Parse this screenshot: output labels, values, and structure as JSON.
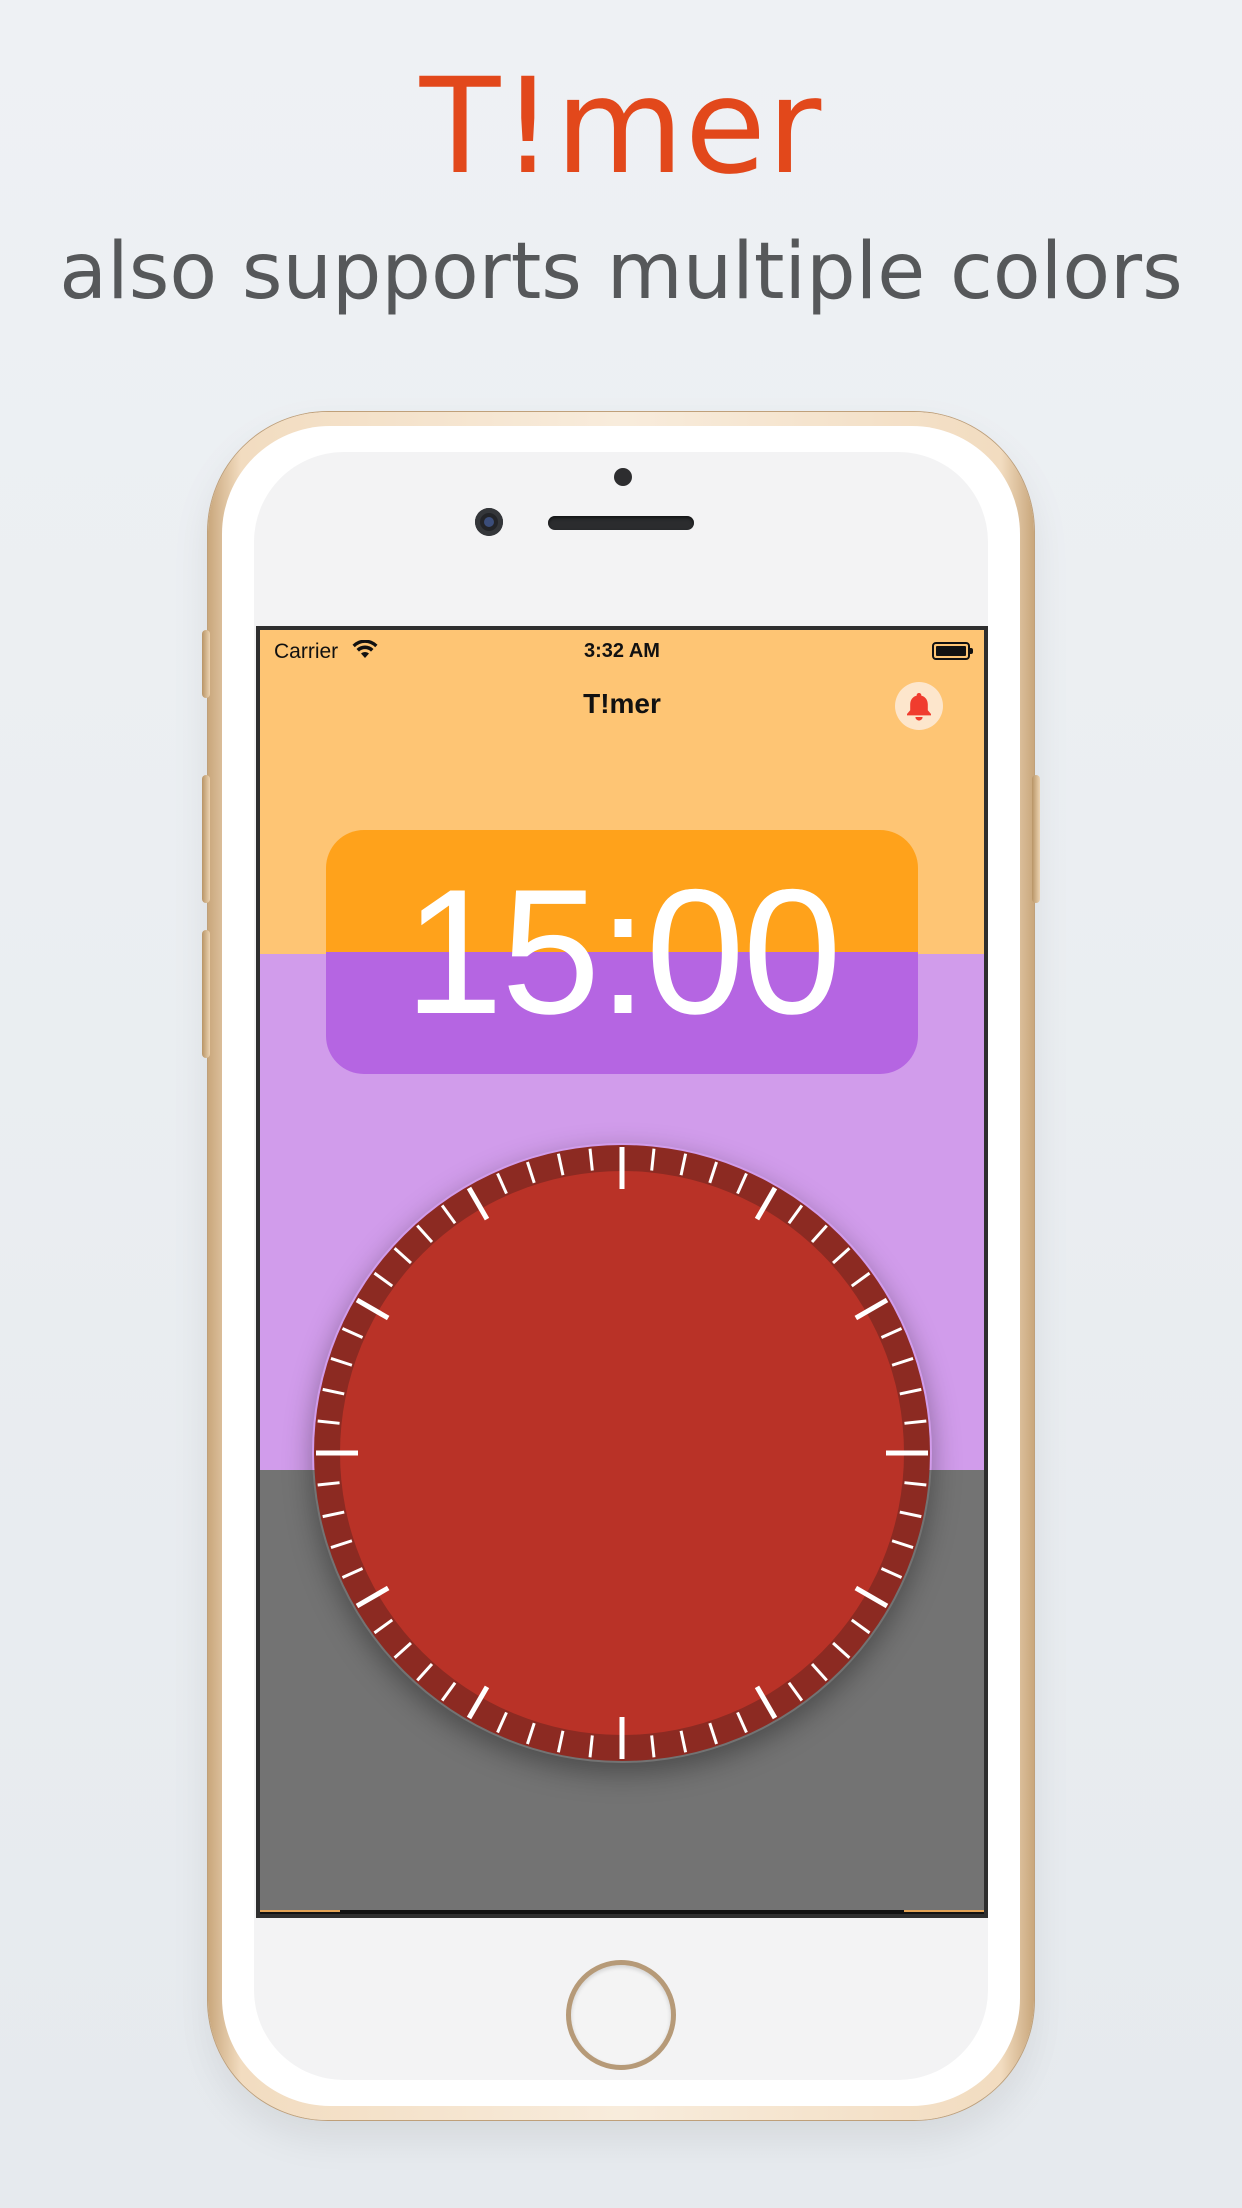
{
  "promo": {
    "title": "T!mer",
    "subtitle": "also supports multiple colors"
  },
  "status_bar": {
    "carrier": "Carrier",
    "time": "3:32 AM",
    "wifi_icon": "wifi-icon",
    "battery_icon": "battery-icon"
  },
  "nav": {
    "title": "T!mer",
    "bell_icon": "bell-icon"
  },
  "timer": {
    "display": "15:00"
  },
  "dial": {
    "tick_count": 60,
    "major_every": 5
  },
  "colors": {
    "title": "#e2481b",
    "band_top": "#fec574",
    "band_middle": "#d19ceb",
    "band_bottom": "#737373",
    "panel_top": "#ffa21b",
    "panel_bottom": "#b565e2",
    "dial_face": "#b93227",
    "dial_ring": "#8c2a22",
    "bell": "#f03c2e"
  }
}
